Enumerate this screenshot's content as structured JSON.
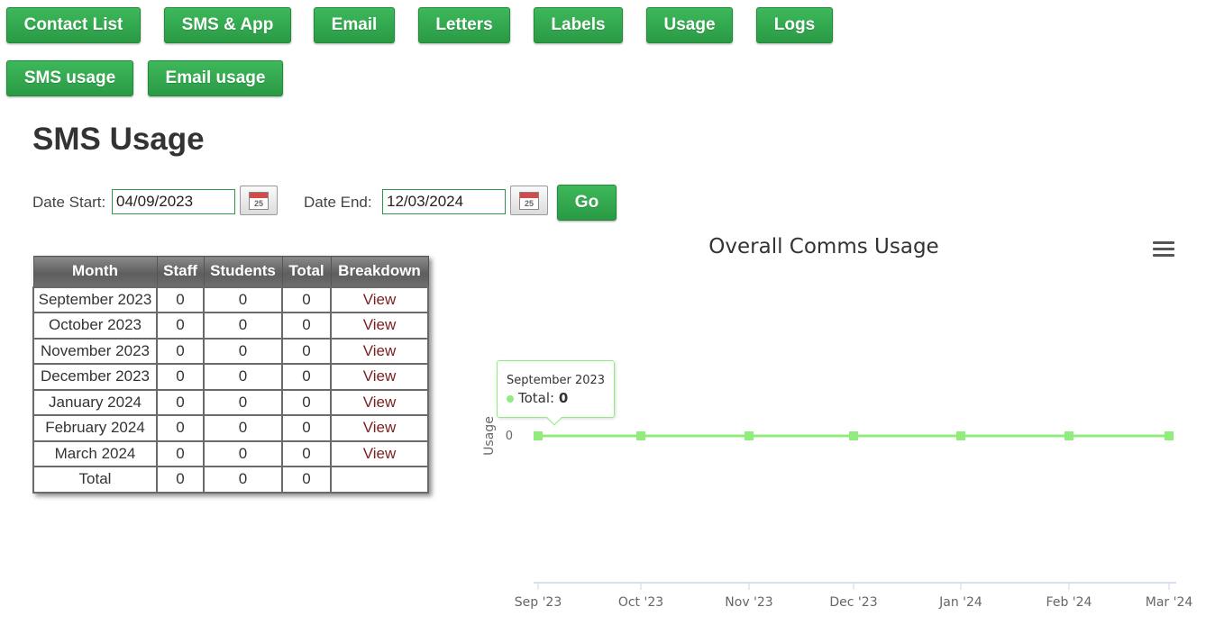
{
  "nav": {
    "main": [
      "Contact List",
      "SMS & App",
      "Email",
      "Letters",
      "Labels",
      "Usage",
      "Logs"
    ],
    "sub": [
      "SMS usage",
      "Email usage"
    ]
  },
  "page": {
    "title": "SMS Usage",
    "date_start_label": "Date Start:",
    "date_start_value": "04/09/2023",
    "date_end_label": "Date End:",
    "date_end_value": "12/03/2024",
    "go_label": "Go",
    "calendar_day": "25"
  },
  "table": {
    "headers": [
      "Month",
      "Staff",
      "Students",
      "Total",
      "Breakdown"
    ],
    "rows": [
      [
        "September 2023",
        "0",
        "0",
        "0",
        "View"
      ],
      [
        "October 2023",
        "0",
        "0",
        "0",
        "View"
      ],
      [
        "November 2023",
        "0",
        "0",
        "0",
        "View"
      ],
      [
        "December 2023",
        "0",
        "0",
        "0",
        "View"
      ],
      [
        "January 2024",
        "0",
        "0",
        "0",
        "View"
      ],
      [
        "February 2024",
        "0",
        "0",
        "0",
        "View"
      ],
      [
        "March 2024",
        "0",
        "0",
        "0",
        "View"
      ],
      [
        "Total",
        "0",
        "0",
        "0",
        ""
      ]
    ]
  },
  "chart_data": {
    "type": "line",
    "title": "Overall Comms Usage",
    "ylabel": "Usage",
    "xlabel": "",
    "categories": [
      "Sep '23",
      "Oct '23",
      "Nov '23",
      "Dec '23",
      "Jan '24",
      "Feb '24",
      "Mar '24"
    ],
    "series": [
      {
        "name": "Total",
        "color": "#90ed7d",
        "values": [
          0,
          0,
          0,
          0,
          0,
          0,
          0
        ]
      }
    ],
    "y_ticks": [
      "0"
    ],
    "tooltip": {
      "title": "September 2023",
      "series": "Total",
      "value": "0"
    },
    "legend": false,
    "grid": false
  }
}
